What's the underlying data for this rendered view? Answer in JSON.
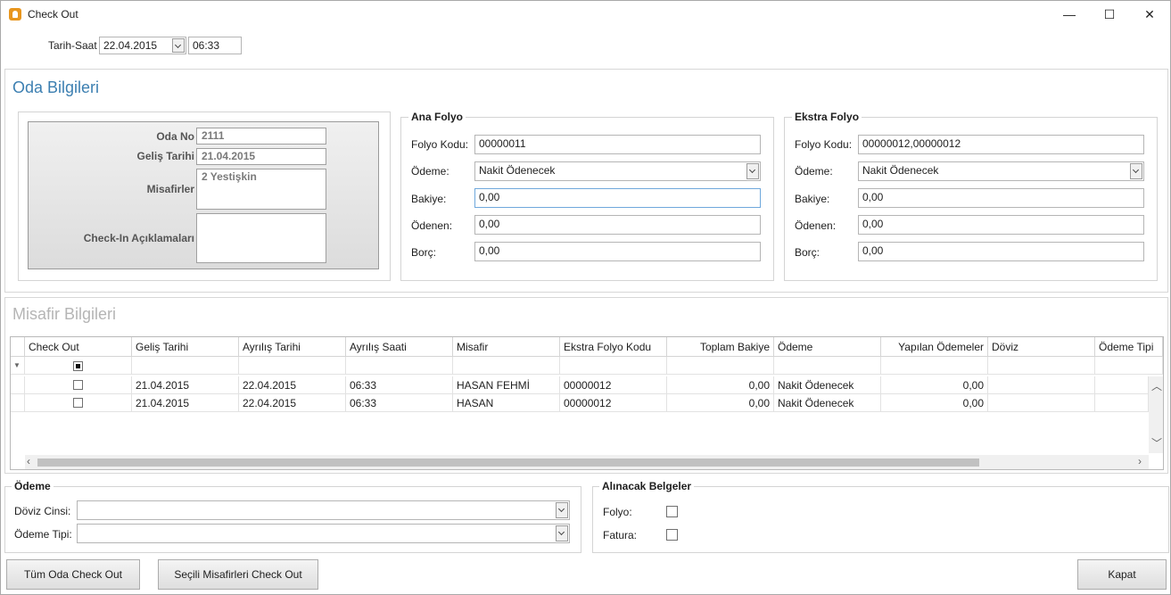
{
  "window": {
    "title": "Check Out",
    "minimize": "—",
    "maximize": "☐",
    "close": "✕"
  },
  "header": {
    "datetime_label": "Tarih-Saat",
    "date": "22.04.2015",
    "time": "06:33"
  },
  "oda": {
    "title": "Oda Bilgileri",
    "oda_no_label": "Oda No",
    "oda_no": "2111",
    "gelis_label": "Geliş Tarihi",
    "gelis": "21.04.2015",
    "misafirler_label": "Misafirler",
    "misafirler": "2 Yestişkin",
    "aciklama_label": "Check-In Açıklamaları",
    "aciklama": ""
  },
  "ana_folyo": {
    "title": "Ana Folyo",
    "kod_label": "Folyo Kodu:",
    "kod": "00000011",
    "odeme_label": "Ödeme:",
    "odeme": "Nakit Ödenecek",
    "bakiye_label": "Bakiye:",
    "bakiye": "0,00",
    "odenen_label": "Ödenen:",
    "odenen": "0,00",
    "borc_label": "Borç:",
    "borc": "0,00"
  },
  "ekstra_folyo": {
    "title": "Ekstra Folyo",
    "kod_label": "Folyo Kodu:",
    "kod": "00000012,00000012",
    "odeme_label": "Ödeme:",
    "odeme": "Nakit Ödenecek",
    "bakiye_label": "Bakiye:",
    "bakiye": "0,00",
    "odenen_label": "Ödenen:",
    "odenen": "0,00",
    "borc_label": "Borç:",
    "borc": "0,00"
  },
  "misafir": {
    "title": "Misafir Bilgileri",
    "columns": [
      "Check Out",
      "Geliş Tarihi",
      "Ayrılış Tarihi",
      "Ayrılış Saati",
      "Misafir",
      "Ekstra Folyo Kodu",
      "Toplam Bakiye",
      "Ödeme",
      "Yapılan Ödemeler",
      "Döviz",
      "Ödeme Tipi"
    ],
    "rows": [
      {
        "checked": false,
        "gelis": "21.04.2015",
        "ayrilis": "22.04.2015",
        "saat": "06:33",
        "misafir": "HASAN FEHMİ",
        "folyo": "00000012",
        "bakiye": "0,00",
        "odeme": "Nakit Ödenecek",
        "yapilan": "0,00",
        "doviz": "",
        "tip": ""
      },
      {
        "checked": false,
        "gelis": "21.04.2015",
        "ayrilis": "22.04.2015",
        "saat": "06:33",
        "misafir": "HASAN",
        "folyo": "00000012",
        "bakiye": "0,00",
        "odeme": "Nakit Ödenecek",
        "yapilan": "0,00",
        "doviz": "",
        "tip": ""
      }
    ]
  },
  "odeme": {
    "title": "Ödeme",
    "doviz_label": "Döviz Cinsi:",
    "doviz": "",
    "tip_label": "Ödeme Tipi:",
    "tip": ""
  },
  "belgeler": {
    "title": "Alınacak Belgeler",
    "folyo_label": "Folyo:",
    "fatura_label": "Fatura:"
  },
  "buttons": {
    "tum_oda": "Tüm Oda Check Out",
    "secili": "Seçili Misafirleri Check Out",
    "kapat": "Kapat"
  }
}
